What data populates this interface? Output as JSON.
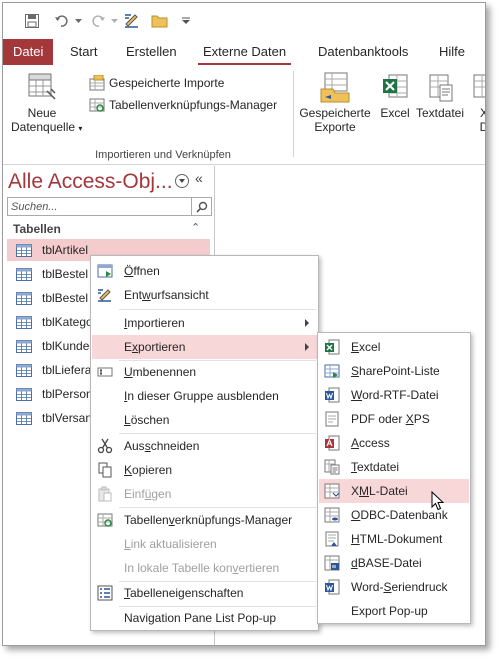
{
  "tabs": [
    {
      "label": "Datei"
    },
    {
      "label": "Start"
    },
    {
      "label": "Erstellen"
    },
    {
      "label": "Externe Daten"
    },
    {
      "label": "Datenbanktools"
    },
    {
      "label": "Hilfe"
    }
  ],
  "ribbon": {
    "new_source_line1": "Neue",
    "new_source_line2": "Datenquelle",
    "saved_imports": "Gespeicherte Importe",
    "linked_table_manager": "Tabellenverknüpfungs-Manager",
    "group_label": "Importieren und Verknüpfen",
    "saved_exports_line1": "Gespeicherte",
    "saved_exports_line2": "Exporte",
    "excel": "Excel",
    "textfile": "Textdatei",
    "more_letter": "X",
    "more_letter2": "D"
  },
  "nav": {
    "title": "Alle Access-Obj...",
    "collapse": "«",
    "search_placeholder": "Suchen...",
    "group": "Tabellen",
    "group_chevron": "⌃",
    "items": [
      {
        "label": "tblArtikel"
      },
      {
        "label": "tblBestel"
      },
      {
        "label": "tblBestel"
      },
      {
        "label": "tblKatego"
      },
      {
        "label": "tblKunde"
      },
      {
        "label": "tblLiefera"
      },
      {
        "label": "tblPerson"
      },
      {
        "label": "tblVersan"
      }
    ]
  },
  "context_menu": {
    "open": {
      "pre": "",
      "u": "Ö",
      "post": "ffnen"
    },
    "design": {
      "pre": "Ent",
      "u": "w",
      "post": "urfsansicht"
    },
    "import": {
      "pre": "",
      "u": "I",
      "post": "mportieren"
    },
    "export": {
      "pre": "E",
      "u": "x",
      "post": "portieren"
    },
    "rename": {
      "pre": "",
      "u": "U",
      "post": "mbenennen"
    },
    "hide": {
      "pre": "",
      "u": "I",
      "post": "n dieser Gruppe ausblenden"
    },
    "delete": {
      "pre": "",
      "u": "L",
      "post": "öschen"
    },
    "cut": {
      "pre": "Aus",
      "u": "s",
      "post": "chneiden"
    },
    "copy": {
      "pre": "",
      "u": "K",
      "post": "opieren"
    },
    "paste": {
      "pre": "Einf",
      "u": "ü",
      "post": "gen"
    },
    "ltm": {
      "pre": "Tabellen",
      "u": "v",
      "post": "erknüpfungs-Manager"
    },
    "refresh": {
      "pre": "",
      "u": "L",
      "post": "ink aktualisieren"
    },
    "convert": {
      "pre": "In lokale Tabelle kon",
      "u": "v",
      "post": "ertieren"
    },
    "props": {
      "pre": "",
      "u": "T",
      "post": "abelleneigenschaften"
    },
    "popup": "Navigation Pane List Pop-up"
  },
  "export_menu": {
    "excel": {
      "pre": "",
      "u": "E",
      "post": "xcel"
    },
    "sharepoint": {
      "pre": "",
      "u": "S",
      "post": "harePoint-Liste"
    },
    "word_rtf": {
      "pre": "",
      "u": "W",
      "post": "ord-RTF-Datei"
    },
    "pdf": {
      "pre": "PDF oder ",
      "u": "X",
      "post": "PS"
    },
    "access": {
      "pre": "",
      "u": "A",
      "post": "ccess"
    },
    "textfile": {
      "pre": "",
      "u": "T",
      "post": "extdatei"
    },
    "xml": {
      "pre": "X",
      "u": "M",
      "post": "L-Datei"
    },
    "odbc": {
      "pre": "",
      "u": "O",
      "post": "DBC-Datenbank"
    },
    "html": {
      "pre": "",
      "u": "H",
      "post": "TML-Dokument"
    },
    "dbase": {
      "pre": "",
      "u": "d",
      "post": "BASE-Datei"
    },
    "word_merge": {
      "pre": "Word-",
      "u": "S",
      "post": "eriendruck"
    },
    "popup": "Export Pop-up"
  },
  "colors": {
    "accent": "#a4373a",
    "highlight": "#f7d7d8",
    "nav_selected": "#f4cccd"
  }
}
